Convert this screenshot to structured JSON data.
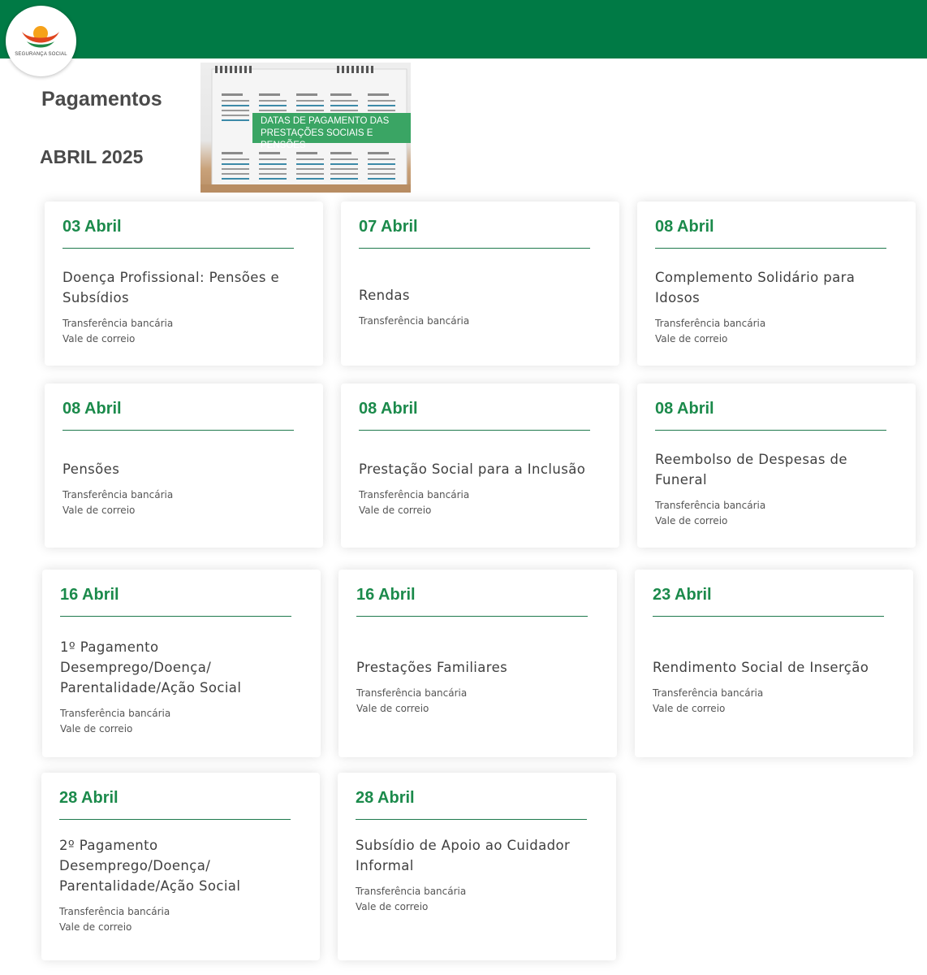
{
  "brand": {
    "logo_text": "SEGURANÇA SOCIAL",
    "color": "#007a45"
  },
  "banner": {
    "label_line1": "DATAS DE PAGAMENTO DAS",
    "label_line2": "PRESTAÇÕES SOCIAIS E PENSÕES"
  },
  "page": {
    "title": "Pagamentos",
    "month": "ABRIL 2025"
  },
  "cards": [
    {
      "date": "03 Abril",
      "title": "Doença Profissional: Pensões e Subsídios",
      "methods": [
        "Transferência bancária",
        "Vale de correio"
      ]
    },
    {
      "date": "07 Abril",
      "title": "Rendas",
      "methods": [
        "Transferência bancária"
      ]
    },
    {
      "date": "08 Abril",
      "title": "Complemento Solidário para Idosos",
      "methods": [
        "Transferência bancária",
        "Vale de correio"
      ]
    },
    {
      "date": "08 Abril",
      "title": "Pensões",
      "methods": [
        "Transferência bancária",
        "Vale de correio"
      ]
    },
    {
      "date": "08 Abril",
      "title": "Prestação Social para a Inclusão",
      "methods": [
        "Transferência bancária",
        "Vale de correio"
      ]
    },
    {
      "date": "08 Abril",
      "title": "Reembolso de Despesas de Funeral",
      "methods": [
        "Transferência bancária",
        "Vale de correio"
      ]
    },
    {
      "date": "16 Abril",
      "title": "1º Pagamento Desemprego/Doença/ Parentalidade/Ação Social",
      "methods": [
        "Transferência bancária",
        "Vale de correio"
      ]
    },
    {
      "date": "16 Abril",
      "title": "Prestações Familiares",
      "methods": [
        "Transferência bancária",
        "Vale de correio"
      ]
    },
    {
      "date": "23 Abril",
      "title": "Rendimento Social de Inserção",
      "methods": [
        "Transferência bancária",
        "Vale de correio"
      ]
    },
    {
      "date": "28 Abril",
      "title": "2º Pagamento Desemprego/Doença/ Parentalidade/Ação Social",
      "methods": [
        "Transferência bancária",
        "Vale de correio"
      ]
    },
    {
      "date": "28 Abril",
      "title": "Subsídio de Apoio ao Cuidador Informal",
      "methods": [
        "Transferência bancária",
        "Vale de correio"
      ]
    }
  ]
}
